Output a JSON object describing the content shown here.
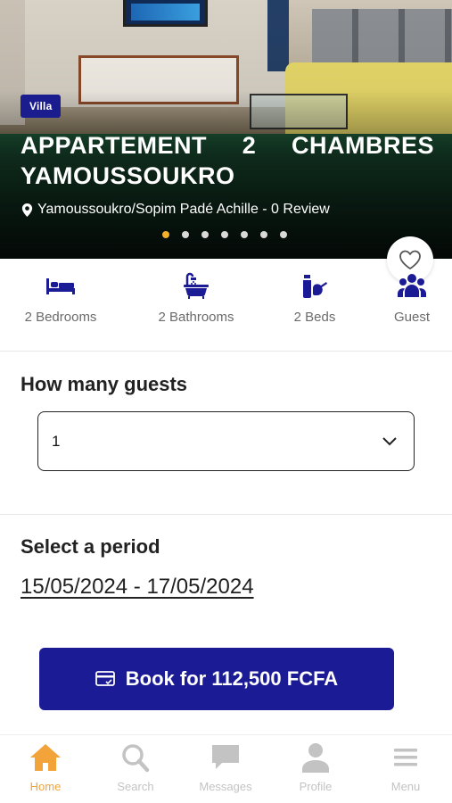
{
  "listing": {
    "badge": "Villa",
    "title": "APPARTEMENT 2 CHAMBRES YAMOUSSOUKRO",
    "location": "Yamoussoukro/Sopim Padé Achille - 0 Review",
    "carousel": {
      "count": 7,
      "active_index": 0
    }
  },
  "features": [
    {
      "icon": "bed-icon",
      "label": "2 Bedrooms"
    },
    {
      "icon": "bathtub-icon",
      "label": "2 Bathrooms"
    },
    {
      "icon": "beds-icon",
      "label": "2 Beds"
    },
    {
      "icon": "guests-icon",
      "label": "Guest"
    }
  ],
  "guests": {
    "title": "How many guests",
    "selected": "1"
  },
  "period": {
    "title": "Select a period",
    "range": "15/05/2024 - 17/05/2024"
  },
  "book_button": {
    "label": "Book for 112,500 FCFA"
  },
  "nav": [
    {
      "label": "Home",
      "icon": "home-icon",
      "active": true
    },
    {
      "label": "Search",
      "icon": "search-icon",
      "active": false
    },
    {
      "label": "Messages",
      "icon": "chat-icon",
      "active": false
    },
    {
      "label": "Profile",
      "icon": "user-icon",
      "active": false
    },
    {
      "label": "Menu",
      "icon": "menu-icon",
      "active": false
    }
  ],
  "colors": {
    "primary": "#1b1b96",
    "accent": "#f2a43a",
    "dot_active": "#f3b12a"
  }
}
